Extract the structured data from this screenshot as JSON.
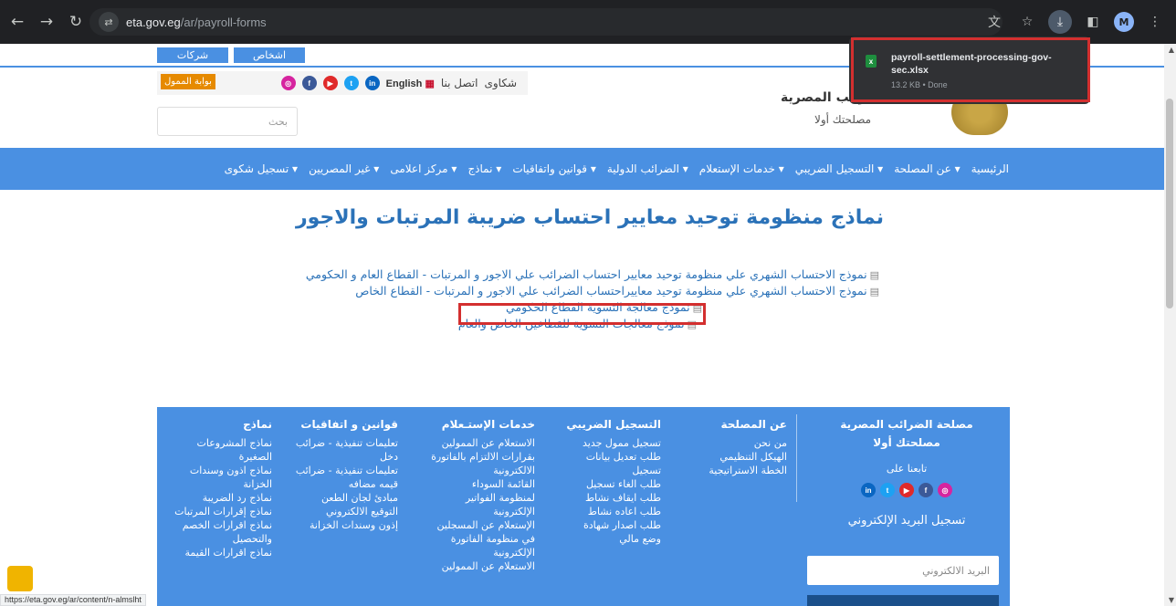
{
  "browser": {
    "url_host": "eta.gov.eg",
    "url_path": "/ar/payroll-forms",
    "profile_initial": "M"
  },
  "download": {
    "filename": "payroll-settlement-processing-gov-sec.xlsx",
    "meta": "13.2 KB • Done",
    "file_icon_letter": "x"
  },
  "site": {
    "top_tabs": [
      "شركات",
      "اشخاص"
    ],
    "portal_button": "بوابة الممول",
    "english_link": "English",
    "contact_link": "اتصل بنا",
    "complaints_link": "شكاوى",
    "search_placeholder": "بحث",
    "org_name": "مصلحة الضرائب المصرية",
    "org_name_visible": "رائب المصرية",
    "motto": "مصلحتك أولا",
    "social": [
      {
        "icon": "instagram-icon",
        "glyph": "◎",
        "color": "#d6249f"
      },
      {
        "icon": "facebook-icon",
        "glyph": "f",
        "color": "#3b5998"
      },
      {
        "icon": "youtube-icon",
        "glyph": "▶",
        "color": "#e02a2a"
      },
      {
        "icon": "twitter-icon",
        "glyph": "t",
        "color": "#1da1f2"
      },
      {
        "icon": "linkedin-icon",
        "glyph": "in",
        "color": "#0a66c2"
      }
    ]
  },
  "nav": {
    "items": [
      "الرئيسية",
      "عن المصلحة ▾",
      "التسجيل الضريبي ▾",
      "خدمات الإستعلام ▾",
      "الضرائب الدولية ▾",
      "قوانين واتفاقيات ▾",
      "نماذج ▾",
      "مركز اعلامى ▾",
      "غير المصريين ▾",
      "تسجيل شكوى ▾"
    ]
  },
  "main": {
    "title": "نماذج منظومة توحيد معايير احتساب ضريبة المرتبات والاجور",
    "links": [
      "نموذج الاحتساب الشهري علي منظومة توحيد معايير احتساب الضرائب علي الاجور و المرتبات - القطاع العام و الحكومي",
      "نموذج الاحتساب الشهري علي منظومة توحيد معاييراحتساب الضرائب علي الاجور و المرتبات - القطاع الخاص",
      "نموذج معالجة التسوية القطاع الحكومي",
      "نموذج معالجات التسوية للقطاعين الخاص والعام"
    ]
  },
  "footer": {
    "brand_title": "مصلحة الضرائب المصرية",
    "brand_motto": "مصلحتك أولا",
    "follow_us": "تابعنا على",
    "email_heading": "تسجيل البريد الإلكتروني",
    "email_placeholder": "البريد الالكتروني",
    "columns": [
      {
        "heading": "عن المصلحة",
        "items": [
          "من نحن",
          "الهيكل التنظيمي",
          "الخطة الاستراتيجية"
        ]
      },
      {
        "heading": "التسجيل الضريبي",
        "items": [
          "تسجيل ممول جديد",
          "طلب تعديل بيانات",
          "تسجيل",
          "طلب الغاء تسجيل",
          "طلب ايقاف نشاط",
          "طلب اعاده نشاط",
          "طلب اصدار شهادة",
          "وضع مالي"
        ]
      },
      {
        "heading": "خدمات الإستـعلام",
        "items": [
          "الاستعلام عن الممولين",
          "بقرارات الالتزام بالفاتورة",
          "الالكترونية",
          "القائمة السوداء",
          "لمنظومة الفواتير",
          "الإلكترونية",
          "الإستعلام عن المسجلين",
          "في منظومة الفاتورة",
          "الإلكترونية",
          "الاستعلام عن الممولين"
        ]
      },
      {
        "heading": "قوانين و اتفاقيات",
        "items": [
          "تعليمات تنفيذية - ضرائب",
          "دخل",
          "تعليمات تنفيذية - ضرائب",
          "قيمه مضافه",
          "مبادئ لجان الطعن",
          "التوقيع الالكتروني",
          "إذون وسندات الخزانة"
        ]
      },
      {
        "heading": "نماذج",
        "items": [
          "نماذج المشروعات",
          "الصغيرة",
          "نماذج اذون وسندات",
          "الخزانة",
          "نماذج رد الضريبة",
          "نماذج إقرارات المرتبات",
          "نماذج اقرارات الخصم",
          "والتحصيل",
          "نماذج اقرارات القيمة"
        ]
      }
    ]
  },
  "status_bar": {
    "url": "https://eta.gov.eg/ar/content/n-almslht"
  }
}
